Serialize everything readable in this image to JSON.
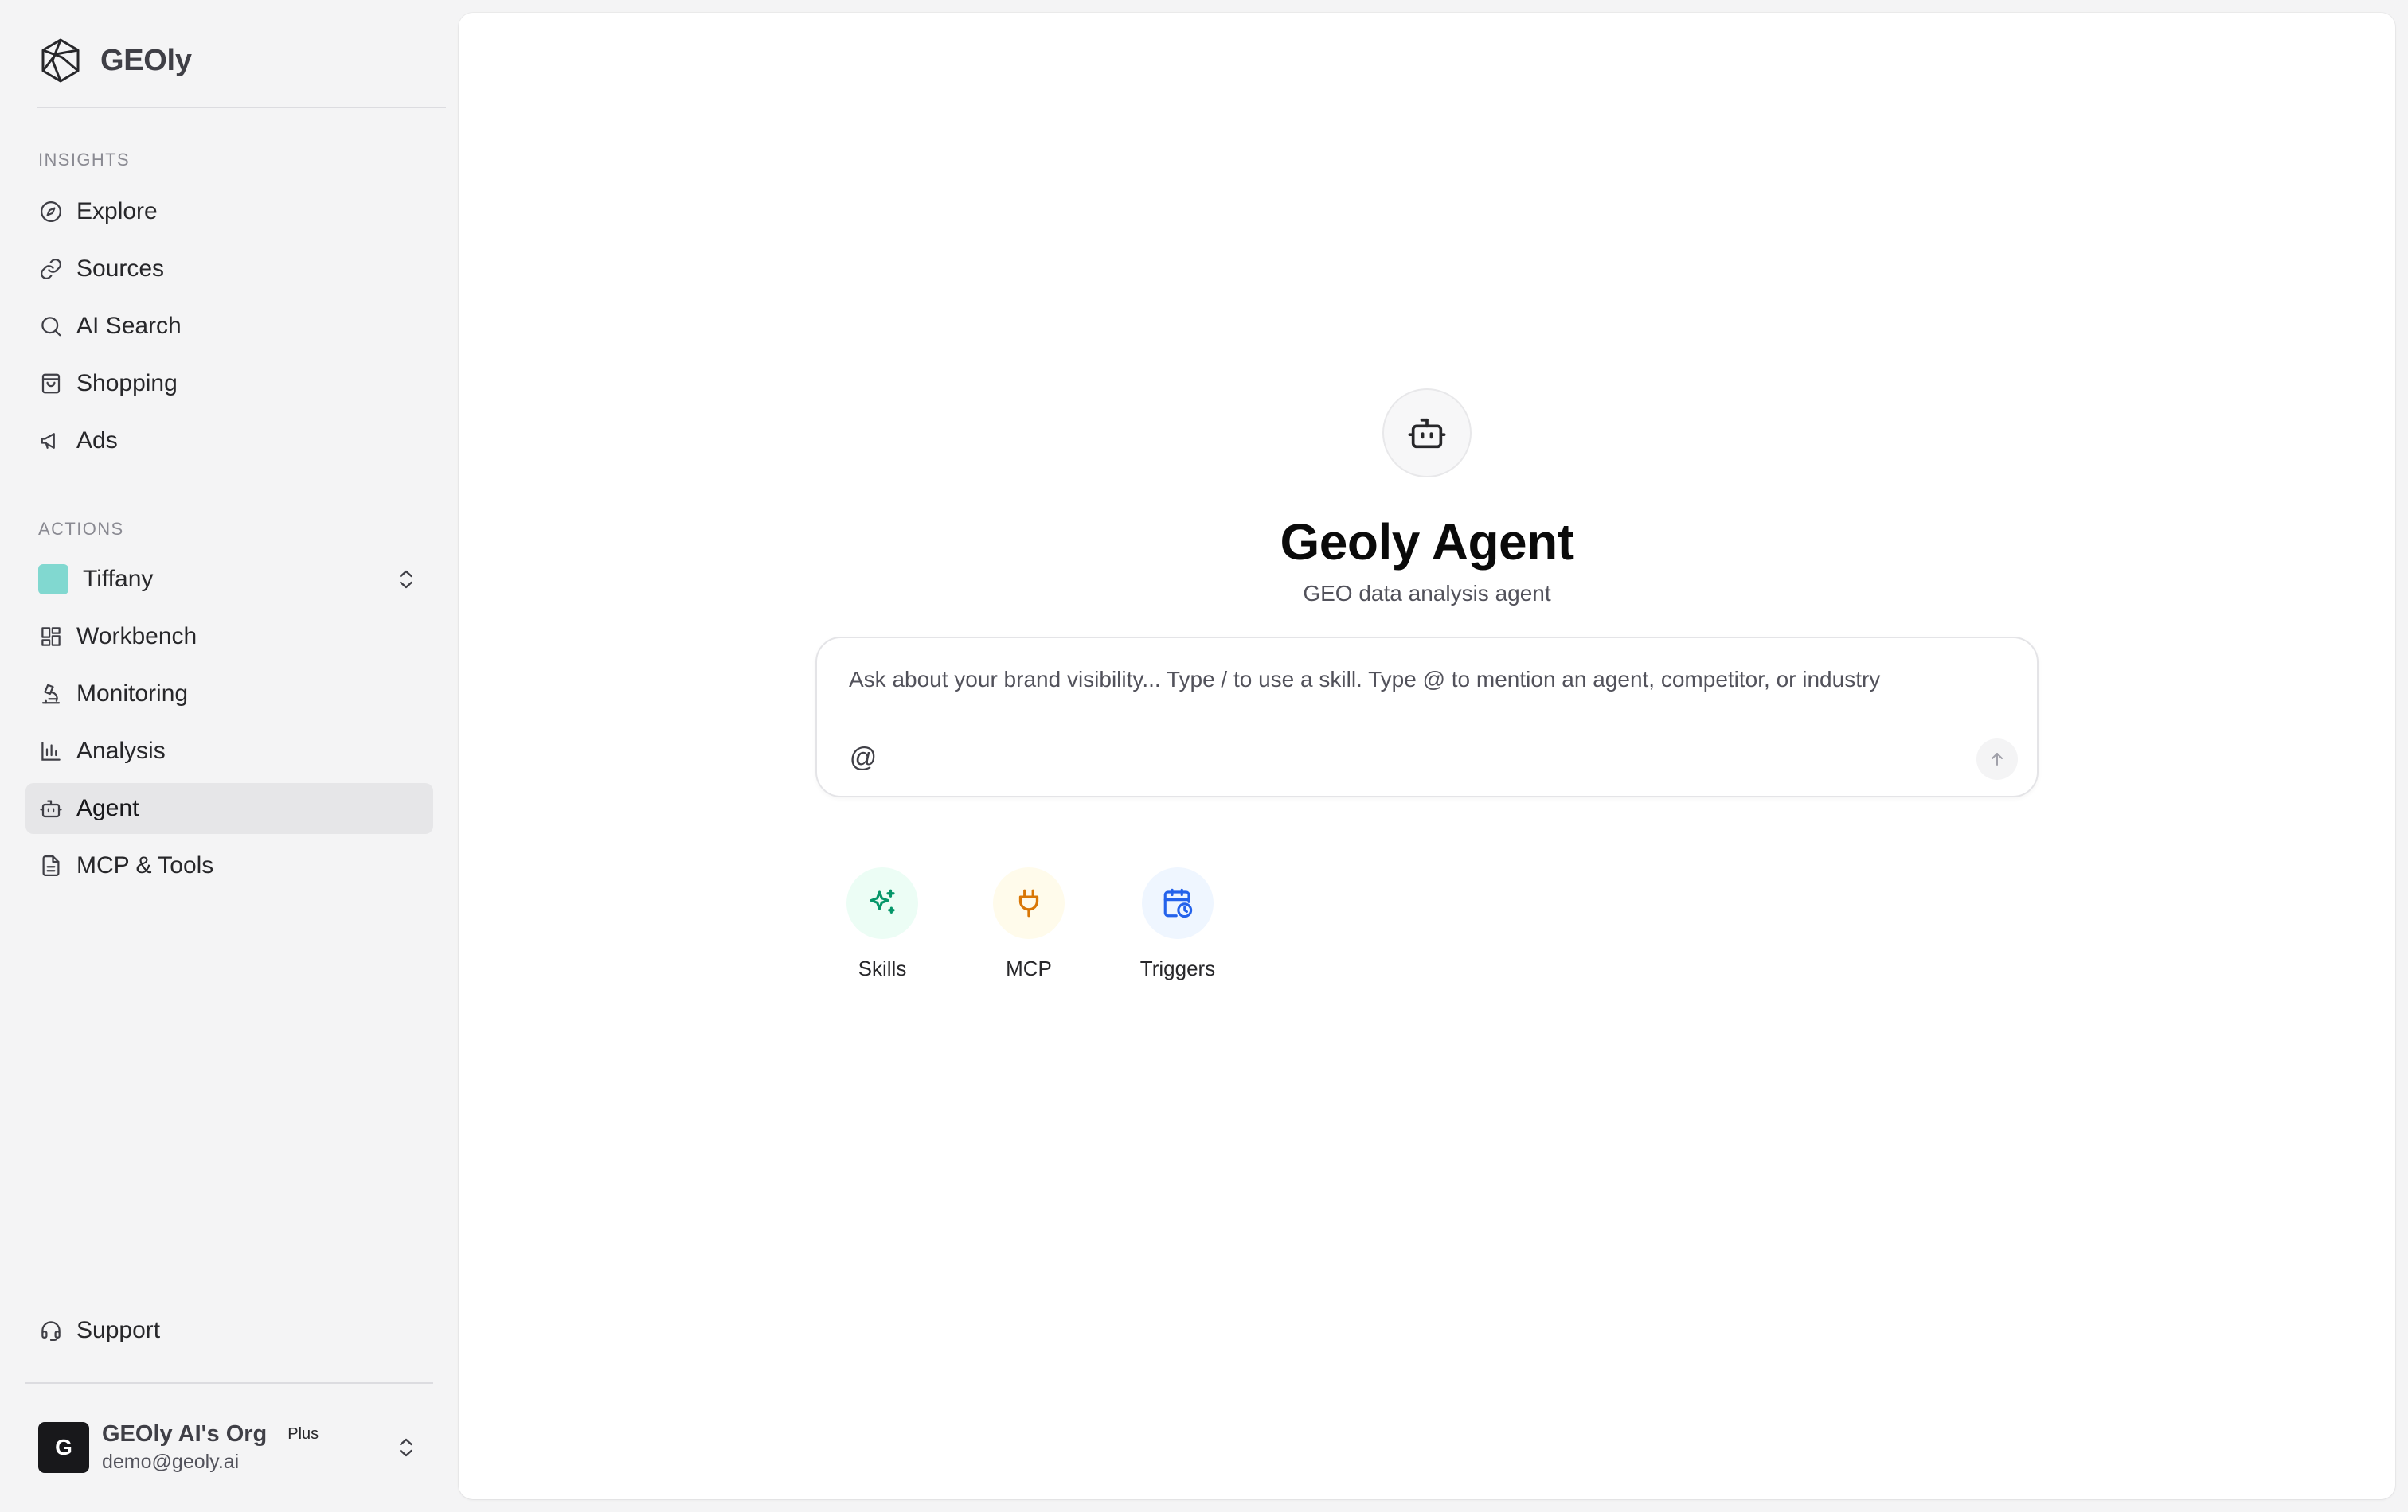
{
  "brand": {
    "name": "GEOly",
    "logo_icon": "hexagon-swirl-logo"
  },
  "sidebar": {
    "insights_label": "INSIGHTS",
    "insights": [
      {
        "label": "Explore",
        "icon": "compass-icon"
      },
      {
        "label": "Sources",
        "icon": "link-icon"
      },
      {
        "label": "AI Search",
        "icon": "search-icon"
      },
      {
        "label": "Shopping",
        "icon": "shopping-bag-icon"
      },
      {
        "label": "Ads",
        "icon": "megaphone-icon"
      }
    ],
    "actions_label": "ACTIONS",
    "workspace": {
      "label": "Tiffany",
      "color": "#81D8D0"
    },
    "actions": [
      {
        "label": "Workbench",
        "icon": "grid-icon"
      },
      {
        "label": "Monitoring",
        "icon": "microscope-icon"
      },
      {
        "label": "Analysis",
        "icon": "bar-chart-icon"
      },
      {
        "label": "Agent",
        "icon": "bot-icon",
        "active": true
      },
      {
        "label": "MCP & Tools",
        "icon": "file-text-icon"
      }
    ],
    "support": {
      "label": "Support",
      "icon": "headset-icon"
    },
    "org": {
      "avatar_letter": "G",
      "name": "GEOly AI's Org",
      "plan": "Plus",
      "email": "demo@geoly.ai"
    }
  },
  "main": {
    "agent_icon": "bot-icon",
    "title": "Geoly Agent",
    "subtitle": "GEO data analysis agent",
    "composer": {
      "placeholder": "Ask about your brand visibility... Type / to use a skill. Type @ to mention an agent, competitor, or industry",
      "value": "",
      "mention_symbol": "@"
    },
    "quick_actions": [
      {
        "label": "Skills",
        "icon": "sparkles-icon",
        "color": "#059669",
        "bg": "#ecfdf5"
      },
      {
        "label": "MCP",
        "icon": "plug-icon",
        "color": "#d97706",
        "bg": "#fffbeb"
      },
      {
        "label": "Triggers",
        "icon": "calendar-clock-icon",
        "color": "#2563eb",
        "bg": "#eff6ff"
      }
    ]
  }
}
